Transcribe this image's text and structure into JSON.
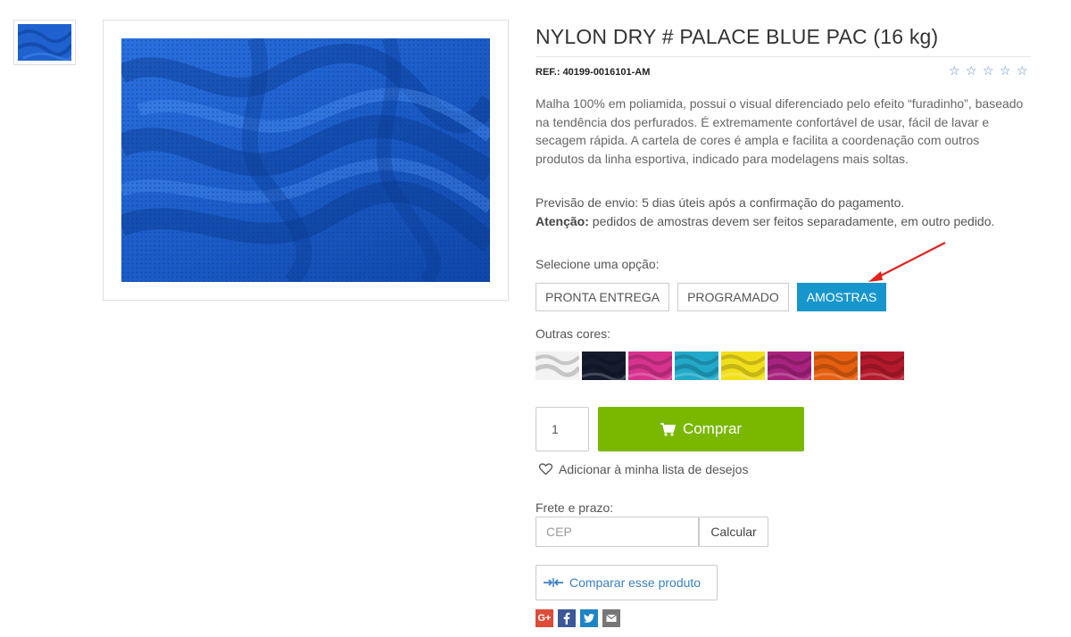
{
  "product": {
    "title": "NYLON DRY # PALACE BLUE PAC (16 kg)",
    "ref_label": "REF.:",
    "ref_value": "40199-0016101-AM",
    "rating_stars": 5,
    "rating_value": 0,
    "description": "Malha 100% em poliamida, possui o visual diferenciado pelo efeito “furadinho”, baseado na tendência dos perfurados. É extremamente confortável de usar, fácil de lavar e secagem rápida. A cartela de cores é ampla e facilita a coordenação com outros produtos da linha esportiva, indicado para modelagens mais soltas.",
    "shipping_forecast": "Previsão de envio: 5 dias úteis após a confirmação do pagamento.",
    "attention_label": "Atenção:",
    "attention_text": " pedidos de amostras devem ser feitos separadamente, em outro pedido.",
    "main_color": "#1f62cf"
  },
  "options": {
    "label": "Selecione uma opção:",
    "items": [
      {
        "label": "PRONTA ENTREGA",
        "selected": false
      },
      {
        "label": "PROGRAMADO",
        "selected": false
      },
      {
        "label": "AMOSTRAS",
        "selected": true
      }
    ]
  },
  "other_colors": {
    "label": "Outras cores:",
    "swatches": [
      {
        "name": "white",
        "color": "#f2f2f2"
      },
      {
        "name": "navy",
        "color": "#141c2e"
      },
      {
        "name": "pink",
        "color": "#d8328f"
      },
      {
        "name": "turquoise",
        "color": "#22a9c9"
      },
      {
        "name": "yellow",
        "color": "#f2df1c"
      },
      {
        "name": "magenta",
        "color": "#a8237f"
      },
      {
        "name": "orange",
        "color": "#e55f10"
      },
      {
        "name": "red",
        "color": "#b51a2c"
      }
    ]
  },
  "purchase": {
    "quantity": "1",
    "buy_label": "Comprar",
    "wishlist_label": "Adicionar à minha lista de desejos"
  },
  "freight": {
    "label": "Frete e prazo:",
    "cep_placeholder": "CEP",
    "calculate_label": "Calcular"
  },
  "compare": {
    "label": "Comparar esse produto"
  },
  "share": [
    {
      "name": "google-plus",
      "text": "G+",
      "color": "#dd4b39"
    },
    {
      "name": "facebook",
      "text": "f",
      "color": "#3b5998"
    },
    {
      "name": "twitter",
      "text": "t",
      "color": "#1e84c6"
    },
    {
      "name": "email",
      "text": "",
      "color": "#777777"
    }
  ],
  "colors": {
    "accent": "#1796cd",
    "buy": "#7ab800",
    "annotation_arrow": "#e3211c"
  }
}
